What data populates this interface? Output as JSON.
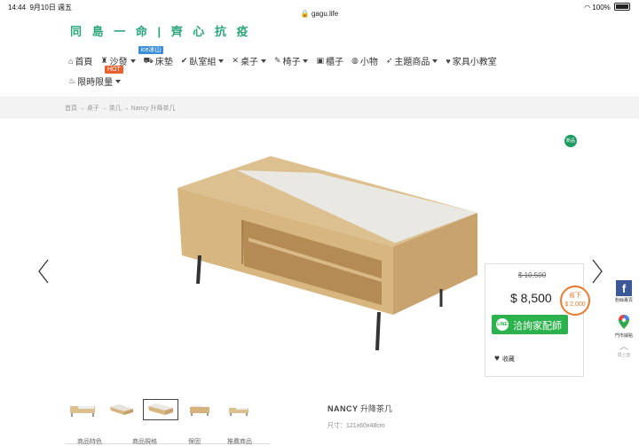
{
  "status": {
    "time": "14:44",
    "date": "9月10日 週五",
    "url": "gagu.life",
    "battery": "100%"
  },
  "slogan": "同 島 一 命 | 齊 心 抗 疫",
  "nav": {
    "items": [
      {
        "label": "首頁",
        "icon": "home-icon"
      },
      {
        "label": "沙發",
        "icon": "sofa-icon"
      },
      {
        "label": "床墊",
        "icon": "bed-icon",
        "badge": "ice冰山"
      },
      {
        "label": "臥室組",
        "icon": "check-circle-icon"
      },
      {
        "label": "桌子",
        "icon": "tools-icon"
      },
      {
        "label": "椅子",
        "icon": "leaf-icon"
      },
      {
        "label": "櫃子",
        "icon": "basket-icon"
      },
      {
        "label": "小物",
        "icon": "bulb-icon"
      },
      {
        "label": "主題商品",
        "icon": "rocket-icon"
      },
      {
        "label": "家具小教室",
        "icon": "heart-icon"
      }
    ],
    "limited": {
      "label": "限時限量",
      "icon": "fire-icon",
      "badge": "HOT"
    }
  },
  "breadcrumb": "首頁 → 桌子 → 茶几 → Nancy 升降茶几",
  "new_tag": "新品",
  "price": {
    "old": "$ 10,500",
    "now": "$ 8,500",
    "save_label": "省下",
    "save_amount": "$ 2,000"
  },
  "line_button": {
    "logo": "LINE",
    "label": "洽詢家配師"
  },
  "favorite": "收藏",
  "side": {
    "fb_label": "粉絲專頁",
    "map_label": "門市據點",
    "top_label": "頂上去"
  },
  "product": {
    "name_en": "NANCY",
    "name_zh": " 升降茶几",
    "size": "尺寸：121x60x48cm"
  },
  "tabs": [
    "商品特色",
    "商品規格",
    "保固",
    "推薦商品"
  ]
}
